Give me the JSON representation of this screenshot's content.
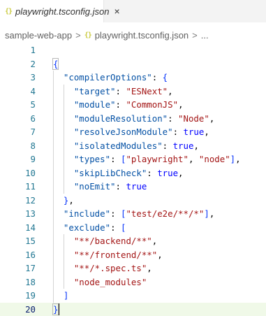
{
  "tab": {
    "icon": "{}",
    "label": "playwright.tsconfig.json",
    "close": "×"
  },
  "breadcrumb": {
    "root": "sample-web-app",
    "sep1": ">",
    "icon": "{}",
    "file": "playwright.tsconfig.json",
    "sep2": ">",
    "ellipsis": "..."
  },
  "editor": {
    "active_line": 20,
    "lines": [
      {
        "n": "1",
        "text": ""
      },
      {
        "n": "2",
        "text": "{"
      },
      {
        "n": "3",
        "text": "  \"compilerOptions\": {"
      },
      {
        "n": "4",
        "text": "    \"target\": \"ESNext\","
      },
      {
        "n": "5",
        "text": "    \"module\": \"CommonJS\","
      },
      {
        "n": "6",
        "text": "    \"moduleResolution\": \"Node\","
      },
      {
        "n": "7",
        "text": "    \"resolveJsonModule\": true,"
      },
      {
        "n": "8",
        "text": "    \"isolatedModules\": true,"
      },
      {
        "n": "9",
        "text": "    \"types\": [\"playwright\", \"node\"],"
      },
      {
        "n": "10",
        "text": "    \"skipLibCheck\": true,"
      },
      {
        "n": "11",
        "text": "    \"noEmit\": true"
      },
      {
        "n": "12",
        "text": "  },"
      },
      {
        "n": "13",
        "text": "  \"include\": [\"test/e2e/**/*\"],"
      },
      {
        "n": "14",
        "text": "  \"exclude\": ["
      },
      {
        "n": "15",
        "text": "    \"**/backend/**\","
      },
      {
        "n": "16",
        "text": "    \"**/frontend/**\","
      },
      {
        "n": "17",
        "text": "    \"**/*.spec.ts\","
      },
      {
        "n": "18",
        "text": "    \"node_modules\""
      },
      {
        "n": "19",
        "text": "  ]"
      },
      {
        "n": "20",
        "text": "}"
      }
    ]
  },
  "colors": {
    "key": "#0451a5",
    "string": "#a31515",
    "keyword": "#0000ff",
    "brace": "#0431fa",
    "line_number": "#237893",
    "active_line_bg": "#f0f9e8"
  }
}
